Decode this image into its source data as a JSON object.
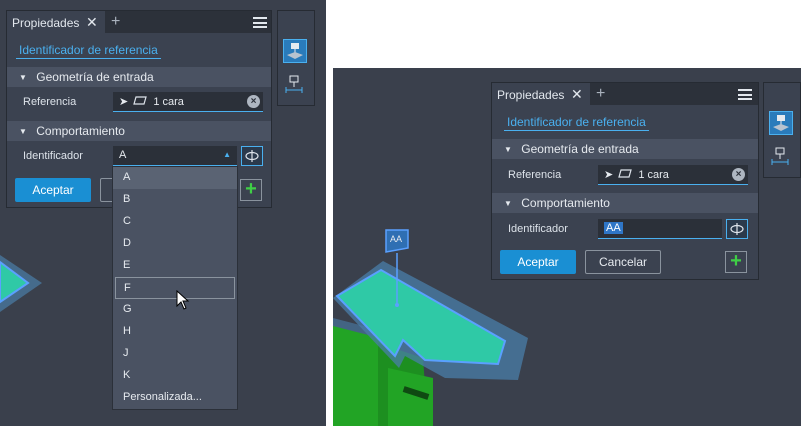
{
  "left": {
    "tab": {
      "label": "Propiedades"
    },
    "ref_link": "Identificador de referencia",
    "sections": {
      "input_geometry": "Geometría de entrada",
      "behavior": "Comportamiento"
    },
    "reference": {
      "label": "Referencia",
      "value": "1 cara"
    },
    "identifier": {
      "label": "Identificador",
      "value": "A"
    },
    "accept": "Aceptar",
    "dropdown": [
      "A",
      "B",
      "C",
      "D",
      "E",
      "F",
      "G",
      "H",
      "J",
      "K",
      "Personalizada..."
    ],
    "hovered_item": "F"
  },
  "right": {
    "tab": {
      "label": "Propiedades"
    },
    "ref_link": "Identificador de referencia",
    "sections": {
      "input_geometry": "Geometría de entrada",
      "behavior": "Comportamiento"
    },
    "reference": {
      "label": "Referencia",
      "value": "1 cara"
    },
    "identifier": {
      "label": "Identificador",
      "value": "AA"
    },
    "accept": "Aceptar",
    "cancel": "Cancelar",
    "callout": "AA"
  },
  "colors": {
    "accent": "#4ab0ef",
    "primary_button": "#1a8fd3",
    "add_green": "#3fcf46",
    "model_face": "#2fc9a6",
    "model_body": "#22a425"
  }
}
